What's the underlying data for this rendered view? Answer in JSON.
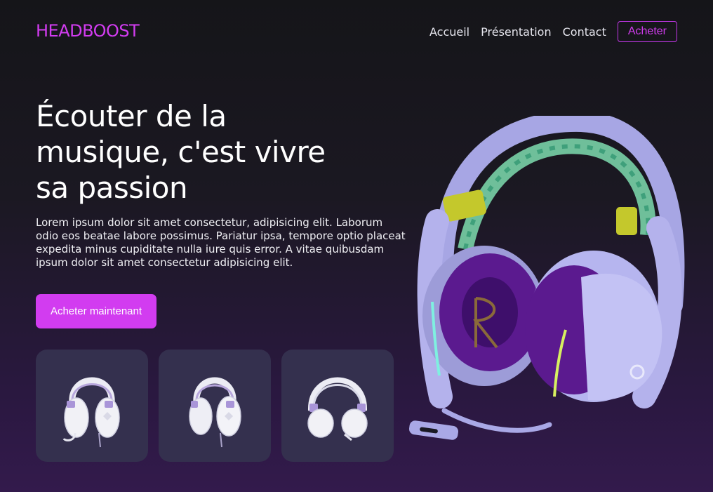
{
  "brand": {
    "logo": "HEADBOOST"
  },
  "nav": {
    "items": [
      "Accueil",
      "Présentation",
      "Contact"
    ],
    "buy_label": "Acheter"
  },
  "hero": {
    "title": "Écouter de la musique, c'est vivre sa passion",
    "description": "Lorem ipsum dolor sit amet consectetur, adipisicing elit. Laborum odio eos beatae labore possimus. Pariatur ipsa, tempore optio placeat expedita minus cupiditate nulla iure quis error. A vitae quibusdam ipsum dolor sit amet consectetur adipisicing elit.",
    "cta_label": "Acheter maintenant"
  },
  "thumbnails": [
    "white-headset-icon",
    "white-headset-icon",
    "white-headset-icon"
  ],
  "colors": {
    "accent": "#d23cf0",
    "thumb_bg": "#34304e",
    "headset_body": "#a9a8e6",
    "ear_cushion": "#5b1a8f"
  }
}
